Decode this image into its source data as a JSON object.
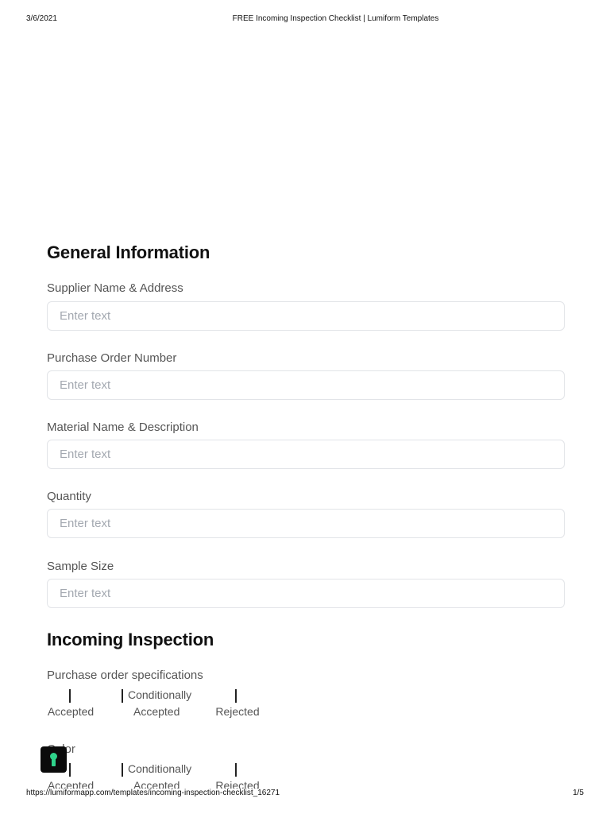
{
  "print_header": {
    "date": "3/6/2021",
    "title": "FREE Incoming Inspection Checklist | Lumiform Templates"
  },
  "general_information": {
    "heading": "General Information",
    "fields": [
      {
        "label": "Supplier Name & Address",
        "placeholder": "Enter text"
      },
      {
        "label": "Purchase Order Number",
        "placeholder": "Enter text"
      },
      {
        "label": "Material Name & Description",
        "placeholder": "Enter text"
      },
      {
        "label": "Quantity",
        "placeholder": "Enter text"
      },
      {
        "label": "Sample Size",
        "placeholder": "Enter text"
      }
    ]
  },
  "incoming_inspection": {
    "heading": "Incoming Inspection",
    "questions": [
      {
        "label": "Purchase order specifications",
        "options": [
          {
            "line1": "",
            "line2": "Accepted"
          },
          {
            "line1": "Conditionally",
            "line2": "Accepted"
          },
          {
            "line1": "",
            "line2": "Rejected"
          }
        ]
      },
      {
        "label": "Color",
        "options": [
          {
            "line1": "",
            "line2": "Accepted"
          },
          {
            "line1": "Conditionally",
            "line2": "Accepted"
          },
          {
            "line1": "",
            "line2": "Rejected"
          }
        ]
      }
    ]
  },
  "print_footer": {
    "url": "https://lumiformapp.com/templates/incoming-inspection-checklist_16271",
    "page": "1/5"
  },
  "icons": {
    "lock_badge": "keyhole-lock-icon"
  },
  "colors": {
    "lock_badge_bg": "#0b0b0b",
    "lock_badge_accent": "#2fd38b",
    "input_border": "#e2e4e8"
  }
}
